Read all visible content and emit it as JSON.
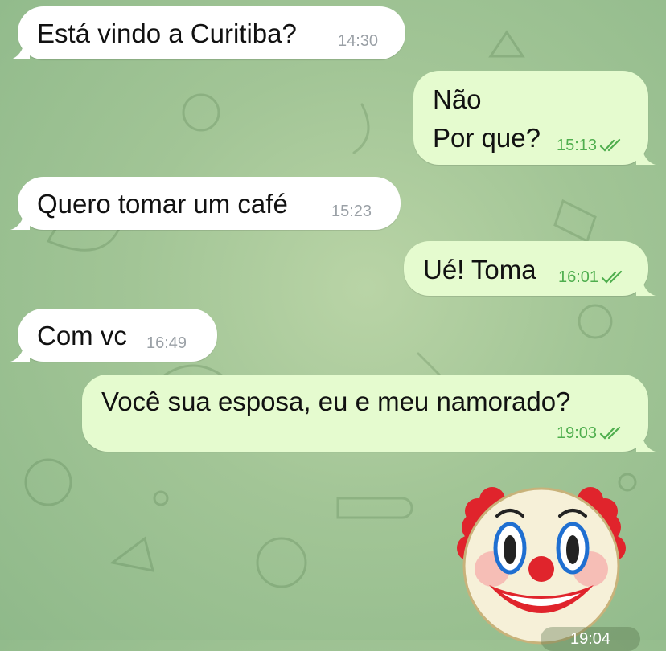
{
  "chat": {
    "messages": [
      {
        "direction": "incoming",
        "lines": [
          "Está vindo a Curitiba?"
        ],
        "time": "14:30"
      },
      {
        "direction": "outgoing",
        "lines": [
          "Não",
          "Por que?"
        ],
        "time": "15:13",
        "status": "read"
      },
      {
        "direction": "incoming",
        "lines": [
          "Quero tomar um café"
        ],
        "time": "15:23"
      },
      {
        "direction": "outgoing",
        "lines": [
          "Ué! Toma"
        ],
        "time": "16:01",
        "status": "read"
      },
      {
        "direction": "incoming",
        "lines": [
          "Com vc"
        ],
        "time": "16:49"
      },
      {
        "direction": "outgoing",
        "lines": [
          "Você sua esposa, eu e meu namorado?"
        ],
        "time": "19:03",
        "status": "read"
      },
      {
        "direction": "outgoing",
        "type": "sticker",
        "sticker": "clown-face-emoji",
        "time": "19:04",
        "status": "read"
      }
    ]
  },
  "colors": {
    "incoming_bubble": "#ffffff",
    "outgoing_bubble": "#e5fbcf",
    "outgoing_meta": "#4fae4e",
    "incoming_meta": "#9aa0a6",
    "wallpaper": "#a2c596"
  }
}
